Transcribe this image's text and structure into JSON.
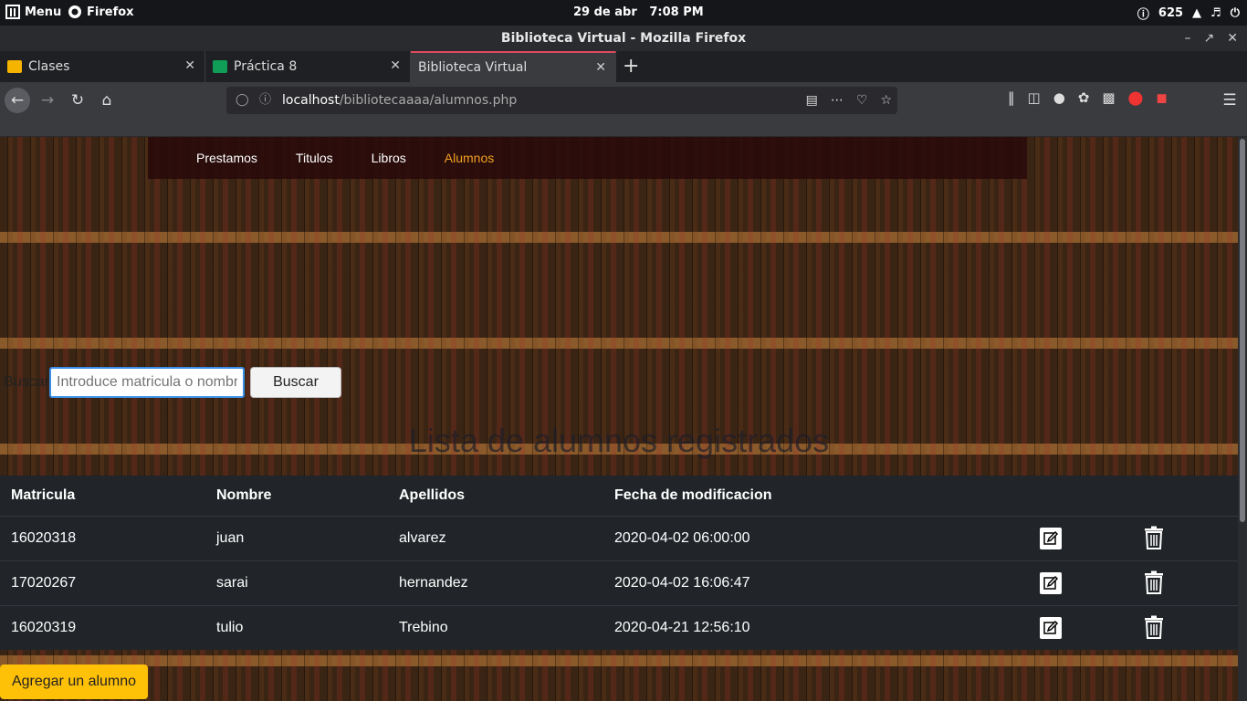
{
  "system": {
    "menu_label": "Menu",
    "app_label": "Firefox",
    "clock": "29 de abr   7:08 PM",
    "notifications": "625"
  },
  "window": {
    "title": "Biblioteca Virtual - Mozilla Firefox"
  },
  "tabs": [
    {
      "label": "Clases",
      "icon_color": "#f4b400"
    },
    {
      "label": "Práctica 8",
      "icon_color": "#0f9d58"
    },
    {
      "label": "Biblioteca Virtual"
    }
  ],
  "address": {
    "host": "localhost",
    "path": "/bibliotecaaaa/alumnos.php"
  },
  "site_nav": {
    "items": [
      "Prestamos",
      "Titulos",
      "Libros",
      "Alumnos"
    ],
    "active": "Alumnos",
    "accent": "#f0a020"
  },
  "search": {
    "label": "Buscar",
    "placeholder": "Introduce matricula o nombre",
    "button": "Buscar"
  },
  "heading": "Lista de alumnos registrados",
  "table": {
    "headers": [
      "Matricula",
      "Nombre",
      "Apellidos",
      "Fecha de modificacion"
    ],
    "rows": [
      {
        "matricula": "16020318",
        "nombre": "juan",
        "apellidos": "alvarez",
        "fecha": "2020-04-02 06:00:00"
      },
      {
        "matricula": "17020267",
        "nombre": "sarai",
        "apellidos": "hernandez",
        "fecha": "2020-04-02 16:06:47"
      },
      {
        "matricula": "16020319",
        "nombre": "tulio",
        "apellidos": "Trebino",
        "fecha": "2020-04-21 12:56:10"
      }
    ],
    "row_actions": [
      "edit-icon",
      "trash-icon"
    ]
  },
  "add_button": "Agregar un alumno",
  "colors": {
    "table_bg": "#212529",
    "add_button": "#ffc107",
    "tab_highlight": "#e04a5f"
  }
}
